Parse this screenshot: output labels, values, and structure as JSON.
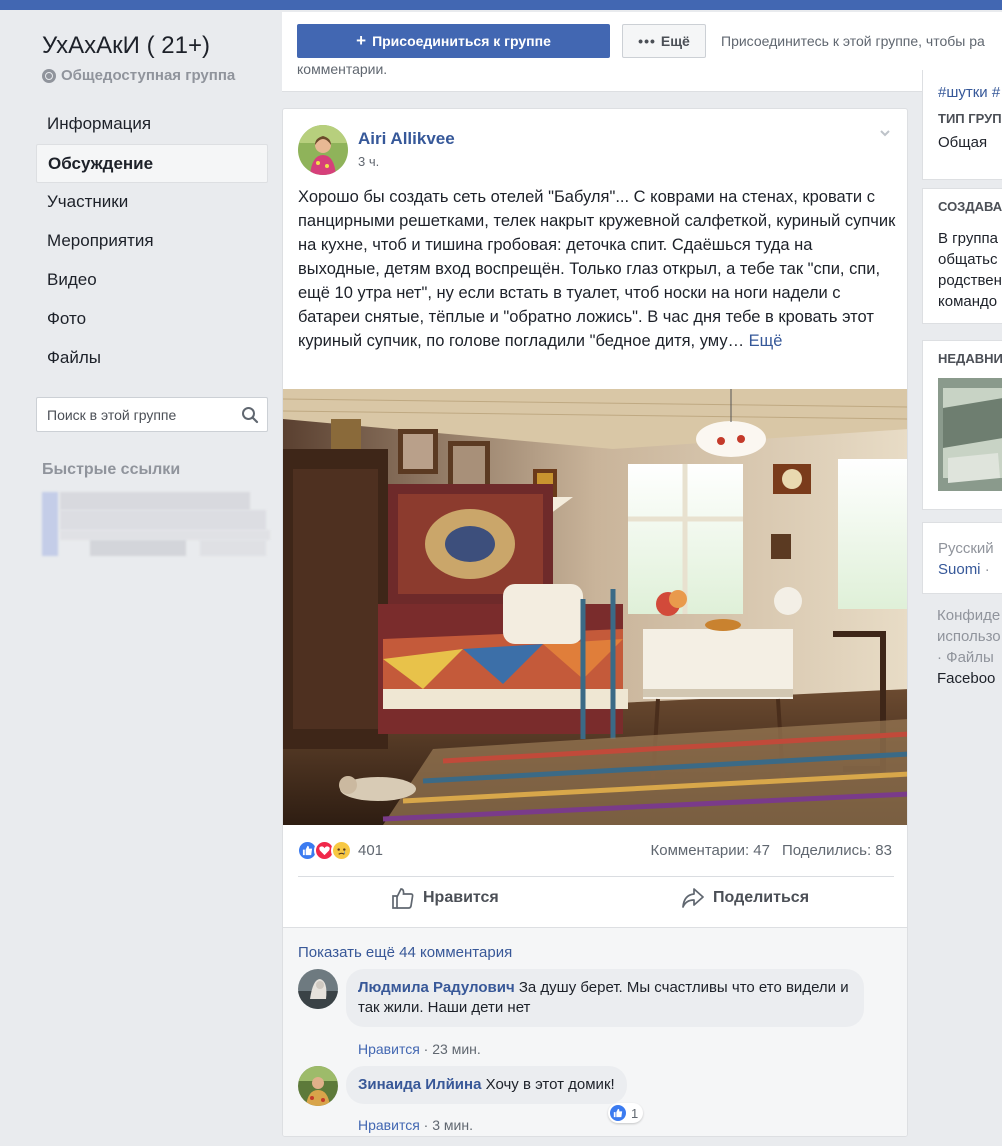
{
  "group": {
    "name": "УхАхАкИ ( 21+)",
    "privacy": "Общедоступная группа"
  },
  "nav": {
    "items": [
      {
        "label": "Информация",
        "active": false
      },
      {
        "label": "Обсуждение",
        "active": true
      },
      {
        "label": "Участники",
        "active": false
      },
      {
        "label": "Мероприятия",
        "active": false
      },
      {
        "label": "Видео",
        "active": false
      },
      {
        "label": "Фото",
        "active": false
      },
      {
        "label": "Файлы",
        "active": false
      }
    ]
  },
  "search": {
    "placeholder": "Поиск в этой группе"
  },
  "quick_links": {
    "title": "Быстрые ссылки"
  },
  "join": {
    "join_label": "Присоединиться к группе",
    "more_label": "Ещё",
    "hint_line1": "Присоединитесь к этой группе, чтобы ра",
    "hint_line2": "комментарии."
  },
  "post": {
    "author": "Airi Allikvee",
    "time": "3 ч.",
    "text": "Хорошо бы создать сеть отелей \"Бабуля\"... С коврами на стенах, кровати с панцирными решетками, телек накрыт кружевной салфеткой, куриный супчик на кухне, чтоб и тишина гробовая: деточка спит. Сдаёшься туда на выходные, детям вход воспрещён. Только глаз открыл, а тебе так \"спи, спи, ещё 10 утра нет\", ну если встать в туалет, чтоб носки на ноги надели с батареи снятые, тёплые и \"обратно ложись\". В час дня тебе в кровать этот куриный супчик, по голове погладили \"бедное дитя, уму…",
    "see_more": "Ещё",
    "reaction_count": "401",
    "comments_count": "Комментарии: 47",
    "shares_count": "Поделились: 83",
    "like_label": "Нравится",
    "share_label": "Поделиться",
    "show_more_comments": "Показать ещё 44 комментария"
  },
  "comments": [
    {
      "name": "Людмила Радулович",
      "text": "За душу берет. Мы счастливы что ето видели и так жили. Наши дети нет",
      "like_label": "Нравится",
      "time": "23 мин."
    },
    {
      "name": "Зинаида Илйина",
      "text": "Хочу в этот домик!",
      "like_label": "Нравится",
      "time": "3 мин.",
      "reaction_count": "1"
    }
  ],
  "right": {
    "tags": "#шутки #",
    "type_head": "ТИП ГРУП",
    "type_value": "Общая",
    "create_head": "СОЗДАВА",
    "create_lines": [
      "В группа",
      "общатьс",
      "родствен",
      "командо"
    ],
    "recent_head": "НЕДАВНИ",
    "lang_current": "Русский",
    "lang_other": "Suomi",
    "lang_sep": "·",
    "footer_lines": [
      "Конфиде",
      "использо",
      "· Файлы",
      "Faceboo"
    ]
  },
  "colors": {
    "brand": "#4267b2",
    "link": "#365899",
    "background": "#e9ebee"
  }
}
